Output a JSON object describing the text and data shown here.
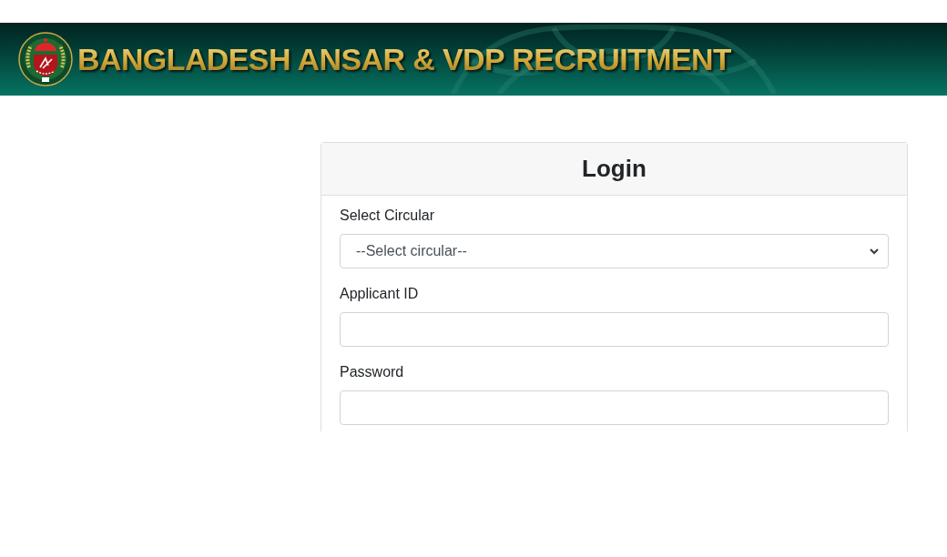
{
  "header": {
    "title": "BANGLADESH ANSAR & VDP RECRUITMENT"
  },
  "login_card": {
    "title": "Login",
    "fields": [
      {
        "kind": "select",
        "label": "Select Circular",
        "value": "--Select circular--"
      },
      {
        "kind": "text",
        "label": "Applicant ID"
      },
      {
        "kind": "password",
        "label": "Password"
      }
    ]
  }
}
